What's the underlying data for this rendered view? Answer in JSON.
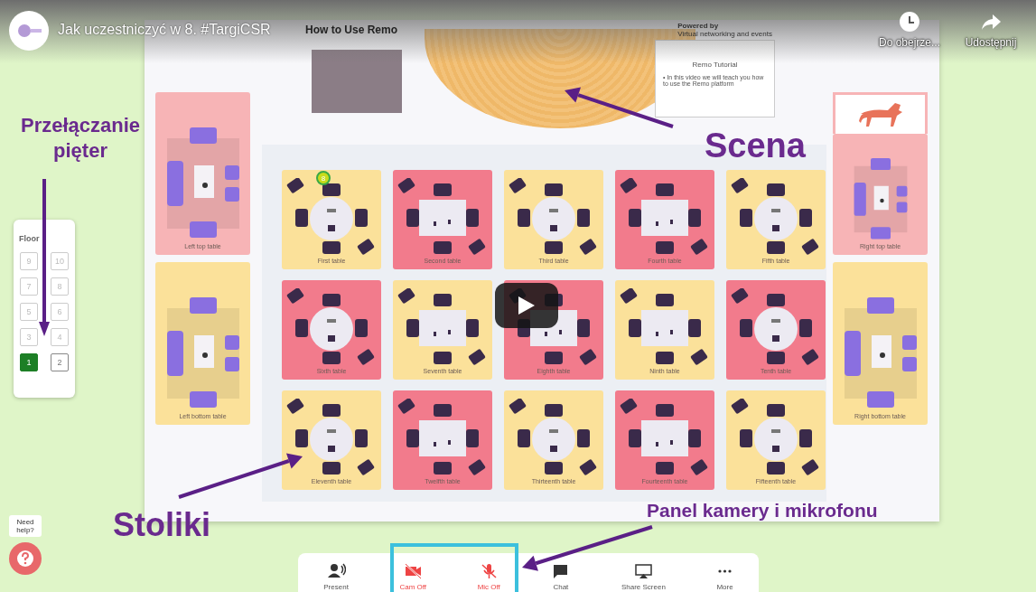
{
  "video": {
    "title": "Jak uczestniczyć w 8. #TargiCSR",
    "watch_later": "Do obejrze...",
    "share": "Udostępnij"
  },
  "remo": {
    "header_title": "How to Use Remo",
    "powered_by": "Powered by",
    "tagline": "Virtual networking and events",
    "tutorial": {
      "title": "Remo Tutorial",
      "text": "• In this video we will teach you how to use the Remo platform"
    },
    "floor_panel": {
      "title": "Floor",
      "floors": [
        {
          "label": "9",
          "selected": false
        },
        {
          "label": "10",
          "selected": false
        },
        {
          "label": "7",
          "selected": false
        },
        {
          "label": "8",
          "selected": false
        },
        {
          "label": "5",
          "selected": false
        },
        {
          "label": "6",
          "selected": false
        },
        {
          "label": "3",
          "selected": false
        },
        {
          "label": "4",
          "selected": false
        },
        {
          "label": "1",
          "selected": true
        },
        {
          "label": "2",
          "selected": false
        }
      ]
    },
    "side_tables_left": [
      {
        "name": "Left top table",
        "color": "#f7b4b6"
      },
      {
        "name": "Left bottom table",
        "color": "#fbe19a"
      }
    ],
    "side_tables_right": [
      {
        "name": "Right top table",
        "color": "#f7b4b6"
      },
      {
        "name": "Right bottom table",
        "color": "#fbe19a"
      }
    ],
    "tables": [
      {
        "name": "First table",
        "kind": "round",
        "color": "#fbe19a",
        "badge": "8"
      },
      {
        "name": "Second table",
        "kind": "square",
        "color": "#f27b8c"
      },
      {
        "name": "Third table",
        "kind": "round",
        "color": "#fbe19a"
      },
      {
        "name": "Fourth table",
        "kind": "square",
        "color": "#f27b8c"
      },
      {
        "name": "Fifth table",
        "kind": "round",
        "color": "#fbe19a"
      },
      {
        "name": "Sixth table",
        "kind": "round",
        "color": "#f27b8c"
      },
      {
        "name": "Seventh table",
        "kind": "square",
        "color": "#fbe19a"
      },
      {
        "name": "Eighth table",
        "kind": "square",
        "color": "#f27b8c"
      },
      {
        "name": "Ninth table",
        "kind": "square",
        "color": "#fbe19a"
      },
      {
        "name": "Tenth table",
        "kind": "round",
        "color": "#f27b8c"
      },
      {
        "name": "Eleventh table",
        "kind": "round",
        "color": "#fbe19a"
      },
      {
        "name": "Twelfth table",
        "kind": "square",
        "color": "#f27b8c"
      },
      {
        "name": "Thirteenth table",
        "kind": "round",
        "color": "#fbe19a"
      },
      {
        "name": "Fourteenth table",
        "kind": "square",
        "color": "#f27b8c"
      },
      {
        "name": "Fifteenth table",
        "kind": "round",
        "color": "#fbe19a"
      }
    ],
    "help": "Need help?",
    "toolbar": [
      {
        "label": "Present",
        "kind": "present",
        "off": false
      },
      {
        "label": "Cam Off",
        "kind": "camera",
        "off": true
      },
      {
        "label": "Mic Off",
        "kind": "mic",
        "off": true
      },
      {
        "label": "Chat",
        "kind": "chat",
        "off": false
      },
      {
        "label": "Share Screen",
        "kind": "share",
        "off": false
      },
      {
        "label": "More",
        "kind": "more",
        "off": false
      }
    ]
  },
  "annotations": {
    "floors": "Przełączanie pięter",
    "stage": "Scena",
    "tables": "Stoliki",
    "panel": "Panel kamery i mikrofonu"
  }
}
